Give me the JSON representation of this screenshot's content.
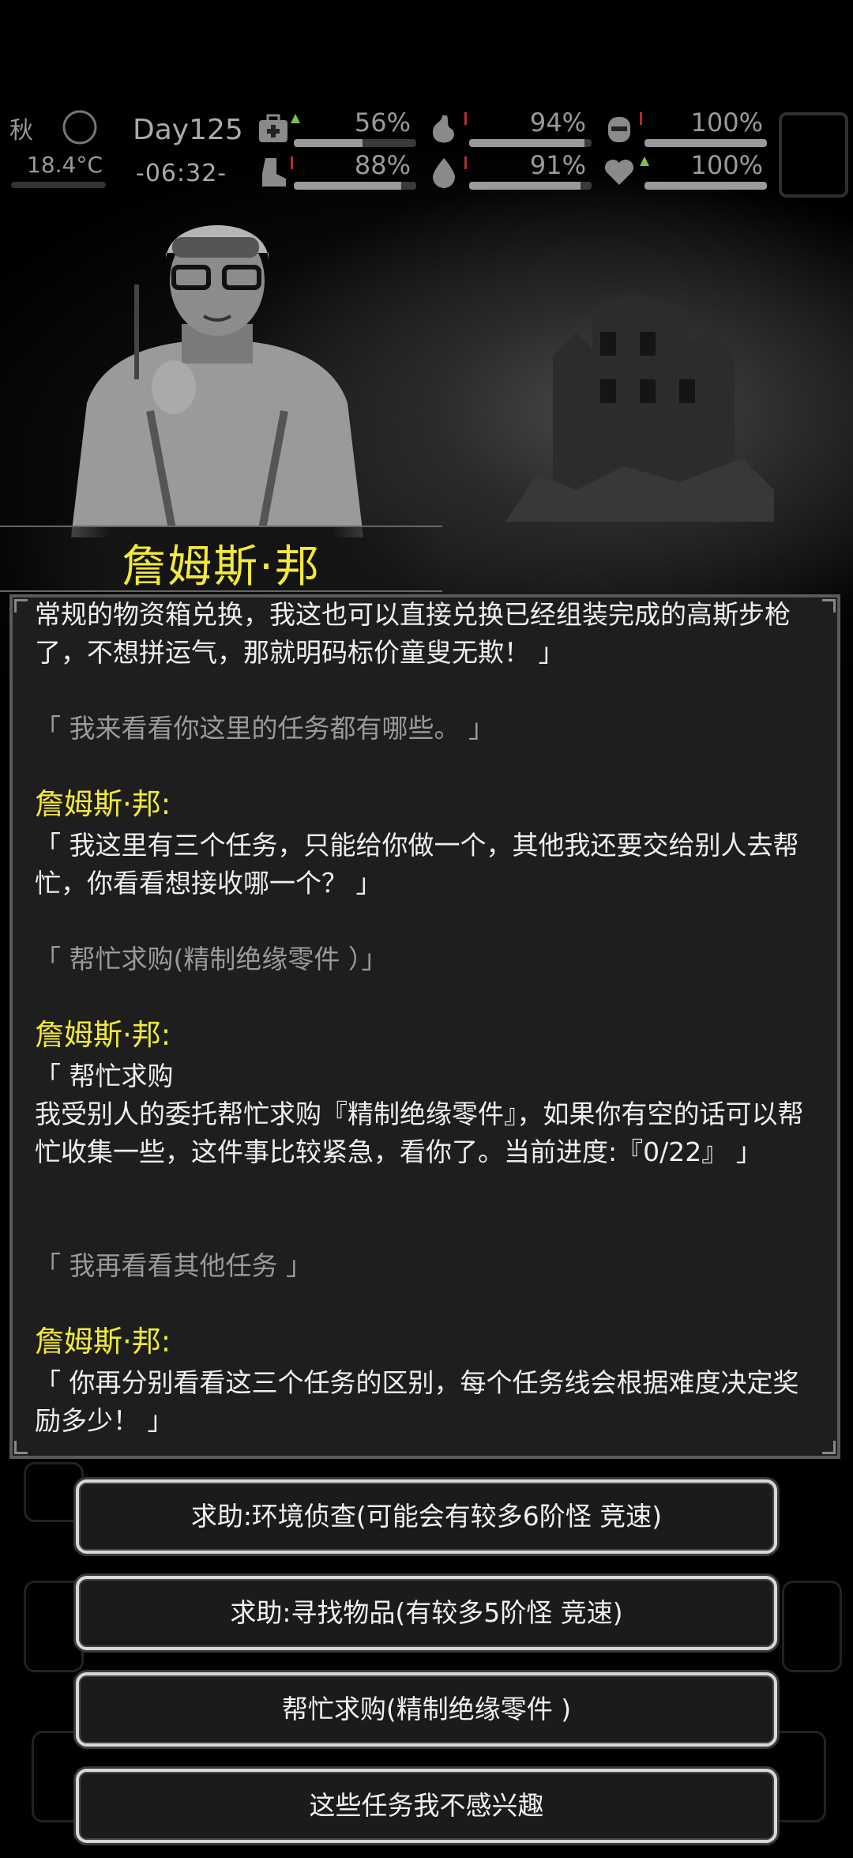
{
  "hud": {
    "season": "秋",
    "temperature": "18.4°C",
    "day": "Day125",
    "time": "-06:32-",
    "stats": [
      {
        "icon": "medkit-icon",
        "value": "56%",
        "level": 0.56,
        "trend": "up"
      },
      {
        "icon": "stomach-icon",
        "value": "94%",
        "level": 0.94,
        "trend": "down"
      },
      {
        "icon": "bladder-icon",
        "value": "100%",
        "level": 1.0,
        "trend": "down"
      },
      {
        "icon": "boot-icon",
        "value": "88%",
        "level": 0.88,
        "trend": "down"
      },
      {
        "icon": "water-drop-icon",
        "value": "91%",
        "level": 0.91,
        "trend": "down"
      },
      {
        "icon": "heart-icon",
        "value": "100%",
        "level": 1.0,
        "trend": "up"
      }
    ]
  },
  "npc": {
    "name": "詹姆斯·邦"
  },
  "dialog": {
    "lines": [
      {
        "style": "white",
        "text": "常规的物资箱兑换，我这也可以直接兑换已经组装完成的高斯步枪了，不想拼运气，那就明码标价童叟无欺！ 」"
      },
      {
        "style": "gray",
        "text": "「 我来看看你这里的任务都有哪些。 」"
      },
      {
        "style": "yellow",
        "text": "詹姆斯·邦:"
      },
      {
        "style": "white",
        "text": "「 我这里有三个任务，只能给你做一个，其他我还要交给别人去帮忙，你看看想接收哪一个？ 」"
      },
      {
        "style": "gray",
        "text": "「 帮忙求购(精制绝缘零件 ）」"
      },
      {
        "style": "yellow",
        "text": "詹姆斯·邦:"
      },
      {
        "style": "white",
        "text": "「 帮忙求购"
      },
      {
        "style": "white",
        "text": "我受别人的委托帮忙求购『精制绝缘零件』，如果你有空的话可以帮忙收集一些，这件事比较紧急，看你了。当前进度:『0/22』 」"
      },
      {
        "style": "gray",
        "text": "「 我再看看其他任务 」"
      },
      {
        "style": "yellow",
        "text": "詹姆斯·邦:"
      },
      {
        "style": "white",
        "text": "「 你再分别看看这三个任务的区别，每个任务线会根据难度决定奖励多少！ 」"
      }
    ]
  },
  "options": [
    {
      "label": "求助:环境侦查(可能会有较多6阶怪  竞速)"
    },
    {
      "label": "求助:寻找物品(有较多5阶怪  竞速)"
    },
    {
      "label": "帮忙求购(精制绝缘零件  )"
    },
    {
      "label": "这些任务我不感兴趣"
    }
  ]
}
